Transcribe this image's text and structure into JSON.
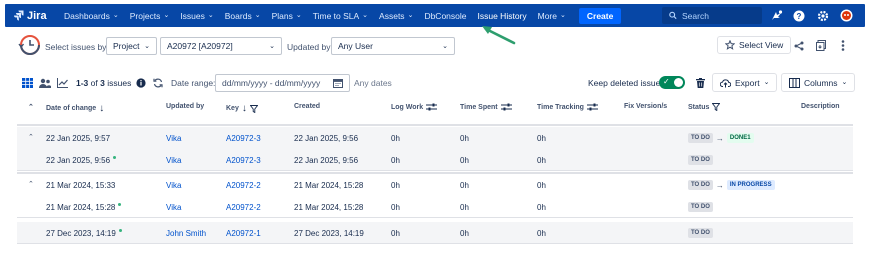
{
  "nav": {
    "logo": "Jira",
    "items": [
      {
        "label": "Dashboards",
        "chevron": true
      },
      {
        "label": "Projects",
        "chevron": true
      },
      {
        "label": "Issues",
        "chevron": true
      },
      {
        "label": "Boards",
        "chevron": true
      },
      {
        "label": "Plans",
        "chevron": true
      },
      {
        "label": "Time to SLA",
        "chevron": true
      },
      {
        "label": "Assets",
        "chevron": true
      },
      {
        "label": "DbConsole",
        "chevron": false
      },
      {
        "label": "Issue History",
        "chevron": false
      },
      {
        "label": "More",
        "chevron": true
      }
    ],
    "create": "Create",
    "search_placeholder": "Search",
    "colors": {
      "bar": "#0747a6",
      "create": "#0065ff",
      "arrow": "#2e9e6e"
    }
  },
  "filters": {
    "select_issues_by": "Select issues by:",
    "project_select": "Project",
    "project_value": "A20972 [A20972]",
    "updated_by": "Updated by:",
    "updated_by_value": "Any User",
    "select_view": "Select View"
  },
  "toolbar": {
    "count_prefix": "1-3",
    "count_of": "of",
    "count_total": "3",
    "count_suffix": "issues",
    "date_range_label": "Date range:",
    "date_range_placeholder": "dd/mm/yyyy - dd/mm/yyyy",
    "any_dates": "Any dates",
    "keep_deleted": "Keep deleted issues",
    "keep_deleted_on": true,
    "export": "Export",
    "columns": "Columns"
  },
  "table": {
    "headers": {
      "date": "Date of change",
      "updated_by": "Updated by",
      "key": "Key",
      "created": "Created",
      "log_work": "Log Work",
      "time_spent": "Time Spent",
      "time_tracking": "Time Tracking",
      "fix_version": "Fix Version/s",
      "status": "Status",
      "description": "Description"
    },
    "groups": [
      {
        "rows": [
          {
            "date": "22 Jan 2025, 9:57",
            "dot": false,
            "updated_by": "Vika",
            "key": "A20972-3",
            "created": "22 Jan 2025, 9:56",
            "log_work": "0h",
            "time_spent": "0h",
            "time_tracking": "0h",
            "status_from": "TO DO",
            "status_to": "DONE1",
            "status_to_color": "green"
          },
          {
            "date": "22 Jan 2025, 9:56",
            "dot": true,
            "updated_by": "Vika",
            "key": "A20972-3",
            "created": "22 Jan 2025, 9:56",
            "log_work": "0h",
            "time_spent": "0h",
            "time_tracking": "0h",
            "status_from": "TO DO",
            "status_to": "",
            "status_to_color": ""
          }
        ]
      },
      {
        "rows": [
          {
            "date": "21 Mar 2024, 15:33",
            "dot": false,
            "updated_by": "Vika",
            "key": "A20972-2",
            "created": "21 Mar 2024, 15:28",
            "log_work": "0h",
            "time_spent": "0h",
            "time_tracking": "0h",
            "status_from": "TO DO",
            "status_to": "IN PROGRESS",
            "status_to_color": "blue"
          },
          {
            "date": "21 Mar 2024, 15:28",
            "dot": true,
            "updated_by": "Vika",
            "key": "A20972-2",
            "created": "21 Mar 2024, 15:28",
            "log_work": "0h",
            "time_spent": "0h",
            "time_tracking": "0h",
            "status_from": "TO DO",
            "status_to": "",
            "status_to_color": ""
          }
        ]
      },
      {
        "rows": [
          {
            "date": "27 Dec 2023, 14:19",
            "dot": true,
            "updated_by": "John Smith",
            "key": "A20972-1",
            "created": "27 Dec 2023, 14:19",
            "log_work": "0h",
            "time_spent": "0h",
            "time_tracking": "0h",
            "status_from": "TO DO",
            "status_to": "",
            "status_to_color": ""
          }
        ]
      }
    ]
  }
}
